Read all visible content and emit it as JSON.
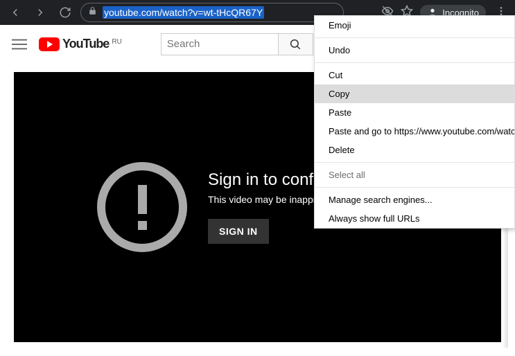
{
  "browser": {
    "url": "youtube.com/watch?v=wt-tHcQR67Y",
    "incognito_label": "Incognito"
  },
  "yt": {
    "logo_text": "YouTube",
    "region": "RU",
    "search_placeholder": "Search"
  },
  "player": {
    "title": "Sign in to confirm your age",
    "subtitle": "This video may be inappropriate for some users.",
    "signin": "SIGN IN"
  },
  "context_menu": {
    "emoji": "Emoji",
    "undo": "Undo",
    "cut": "Cut",
    "copy": "Copy",
    "paste": "Paste",
    "paste_go": "Paste and go to https://www.youtube.com/watch?v",
    "delete": "Delete",
    "select_all": "Select all",
    "manage": "Manage search engines...",
    "full_urls": "Always show full URLs"
  }
}
